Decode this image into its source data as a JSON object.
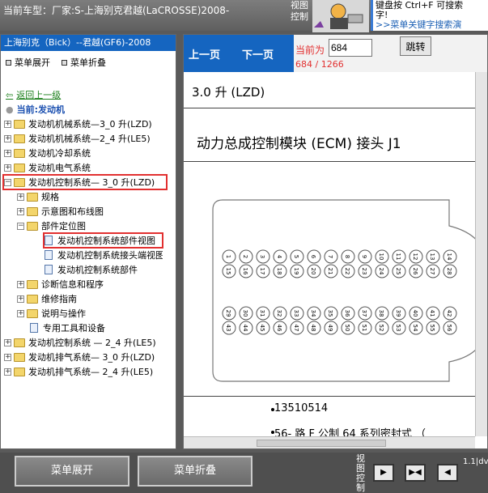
{
  "header": {
    "vehicle_label": "当前车型：厂家:S-上海别克君越(LaCROSSE)2008-",
    "view_label": "视图控制",
    "hint_line1": "键盘按 Ctrl+F 可搜索",
    "hint_line2": "字!",
    "hint_link": ">>菜单关键字搜索演"
  },
  "left": {
    "title": "上海别克（Bick）--君越(GF6)-2008",
    "expand_menu": "菜单展开",
    "collapse_menu": "菜单折叠",
    "back": "返回上一级",
    "current": "当前:发动机",
    "items": [
      "发动机机械系统—3_0 升(LZD)",
      "发动机机械系统—2_4 升(LE5)",
      "发动机冷却系统",
      "发动机电气系统",
      "发动机控制系统— 3_0 升(LZD)",
      "规格",
      "示意图和布线图",
      "部件定位图",
      "发动机控制系统部件视图",
      "发动机控制系统接头端视图",
      "发动机控制系统部件",
      "诊断信息和程序",
      "维修指南",
      "说明与操作",
      "专用工具和设备",
      "发动机控制系统 — 2_4 升(LE5)",
      "发动机排气系统— 3_0 升(LZD)",
      "发动机排气系统— 2_4 升(LE5)"
    ]
  },
  "nav": {
    "prev": "上一页",
    "next": "下一页",
    "current_label": "当前为",
    "page_value": "684",
    "jump": "跳转",
    "page_count": "684 / 1266"
  },
  "content": {
    "engine_line": "3.0 升 (LZD)",
    "heading": "动力总成控制模块 (ECM) 接头 J1",
    "bullet1": "13510514",
    "bullet2": "56- 路 F 公制 64 系列密封式 （",
    "pin_rows": [
      [
        "1\n15",
        "2\n16",
        "3\n17",
        "4\n18",
        "5\n19",
        "6\n20",
        "7\n21",
        "8\n22",
        "9\n23",
        "10\n24",
        "11\n25",
        "12\n26",
        "13\n27",
        "14\n28"
      ],
      [
        "29\n43",
        "30\n44",
        "31\n45",
        "32\n46",
        "33\n47",
        "34\n48",
        "35\n49",
        "36\n50",
        "37\n51",
        "38\n52",
        "39\n53",
        "40\n54",
        "41\n55",
        "42\n56"
      ]
    ]
  },
  "bottom": {
    "expand": "菜单展开",
    "collapse": "菜单折叠",
    "view_label": "视图控制",
    "version": "1.1|dv"
  }
}
